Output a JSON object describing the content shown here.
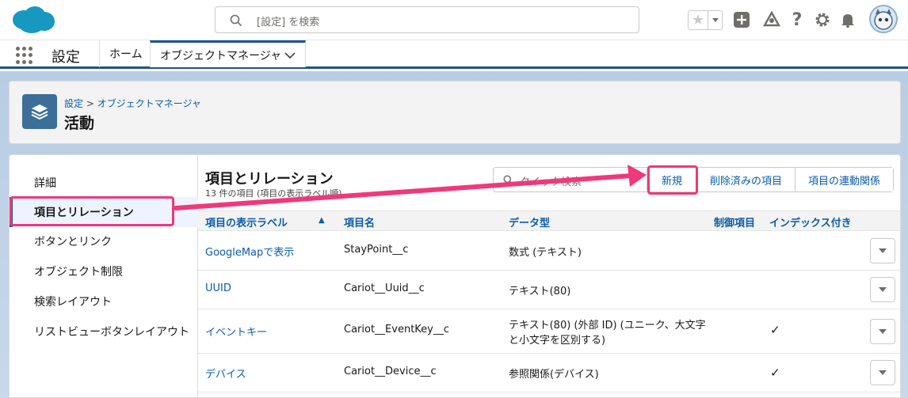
{
  "header": {
    "search_placeholder": "[設定] を検索"
  },
  "appnav": {
    "app_name": "設定",
    "tabs": [
      "ホーム",
      "オブジェクトマネージャ"
    ]
  },
  "page_header": {
    "breadcrumb": [
      "設定",
      "オブジェクトマネージャ"
    ],
    "breadcrumb_separator": ">",
    "title": "活動"
  },
  "sidebar": {
    "items": [
      "詳細",
      "項目とリレーション",
      "ボタンとリンク",
      "オブジェクト制限",
      "検索レイアウト",
      "リストビューボタンレイアウト"
    ],
    "active_index": 1
  },
  "content": {
    "title": "項目とリレーション",
    "subtitle": "13 件の項目 (項目の表示ラベル順)",
    "quick_search_placeholder": "クイック検索",
    "buttons": [
      "新規",
      "削除済みの項目",
      "項目の連動関係"
    ],
    "columns": [
      "項目の表示ラベル",
      "項目名",
      "データ型",
      "制御項目",
      "インデックス付き"
    ],
    "sort_indicator": "▲",
    "rows": [
      {
        "label": "GoogleMapで表示",
        "name": "StayPoint__c",
        "type": [
          "数式 (テキスト)"
        ],
        "controlling": "",
        "indexed": ""
      },
      {
        "label": "UUID",
        "name": "Cariot__Uuid__c",
        "type": [
          "テキスト(80)"
        ],
        "controlling": "",
        "indexed": ""
      },
      {
        "label": "イベントキー",
        "name": "Cariot__EventKey__c",
        "type": [
          "テキスト(80) (外部 ID) (ユニーク、大文字",
          "と小文字を区別する)"
        ],
        "controlling": "",
        "indexed": "✓"
      },
      {
        "label": "デバイス",
        "name": "Cariot__Device__c",
        "type": [
          "参照関係(デバイス)"
        ],
        "controlling": "",
        "indexed": "✓"
      }
    ]
  },
  "colors": {
    "brand": "#1b5297",
    "link": "#0b5cab",
    "highlight": "#f0387a",
    "object_icon": "#3c6e9a"
  }
}
